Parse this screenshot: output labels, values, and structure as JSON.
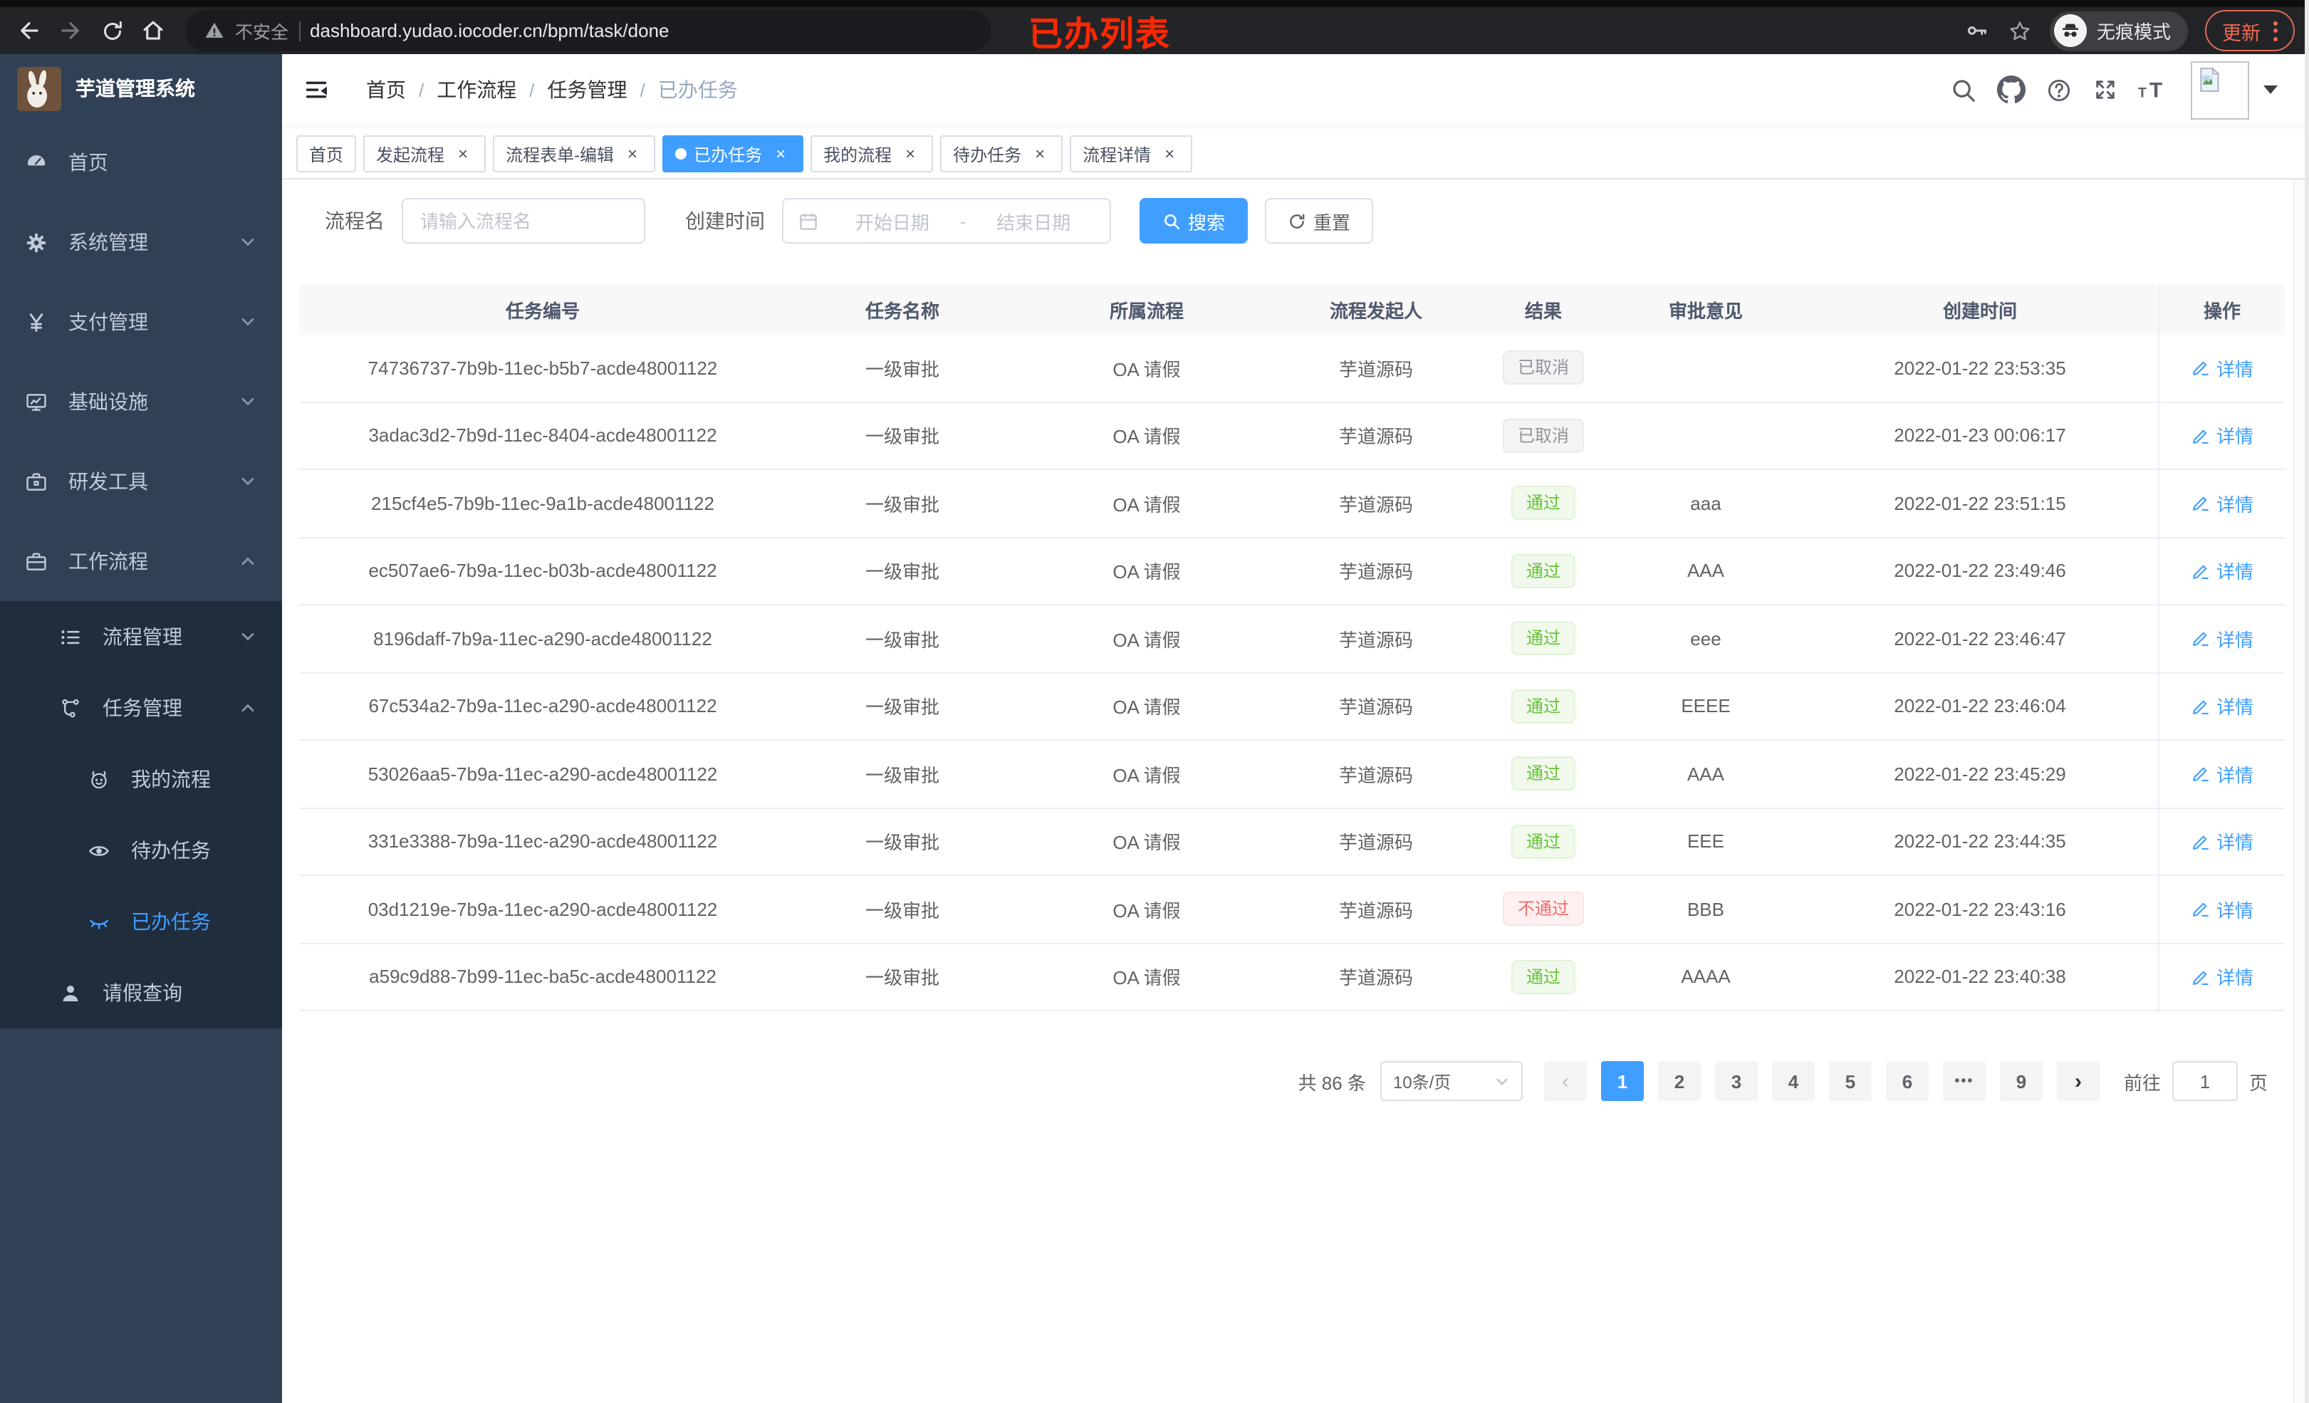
{
  "annotation": {
    "text": "已办列表"
  },
  "browser": {
    "security_label": "不安全",
    "url": "dashboard.yudao.iocoder.cn/bpm/task/done",
    "incognito_label": "无痕模式",
    "update_label": "更新",
    "nav_icons": [
      "back-icon",
      "forward-icon",
      "reload-icon",
      "home-icon"
    ],
    "right_icons": [
      "key-icon",
      "star-icon"
    ]
  },
  "sidebar": {
    "logo_title": "芋道管理系统",
    "items": [
      {
        "key": "home",
        "label": "首页",
        "icon": "dashboard-icon",
        "level": 1,
        "submenu": false,
        "chevron": "",
        "active": false
      },
      {
        "key": "system-mgmt",
        "label": "系统管理",
        "icon": "gear-icon",
        "level": 1,
        "submenu": false,
        "chevron": "down",
        "active": false
      },
      {
        "key": "payment-mgmt",
        "label": "支付管理",
        "icon": "yen-icon",
        "level": 1,
        "submenu": false,
        "chevron": "down",
        "active": false
      },
      {
        "key": "infrastructure",
        "label": "基础设施",
        "icon": "monitor-icon",
        "level": 1,
        "submenu": false,
        "chevron": "down",
        "active": false
      },
      {
        "key": "dev-tools",
        "label": "研发工具",
        "icon": "toolbox-icon",
        "level": 1,
        "submenu": false,
        "chevron": "down",
        "active": false
      },
      {
        "key": "workflow",
        "label": "工作流程",
        "icon": "briefcase-icon",
        "level": 1,
        "submenu": false,
        "chevron": "up",
        "active": false
      },
      {
        "key": "process-mgmt",
        "label": "流程管理",
        "icon": "list-icon",
        "level": 2,
        "submenu": true,
        "chevron": "down",
        "active": false
      },
      {
        "key": "task-mgmt",
        "label": "任务管理",
        "icon": "flow-icon",
        "level": 2,
        "submenu": true,
        "chevron": "up",
        "active": false
      },
      {
        "key": "my-process",
        "label": "我的流程",
        "icon": "face-icon",
        "level": 3,
        "submenu": true,
        "chevron": "",
        "active": false
      },
      {
        "key": "todo-tasks",
        "label": "待办任务",
        "icon": "eye-icon",
        "level": 3,
        "submenu": true,
        "chevron": "",
        "active": false
      },
      {
        "key": "done-tasks",
        "label": "已办任务",
        "icon": "eye-closed-icon",
        "level": 3,
        "submenu": true,
        "chevron": "",
        "active": true
      },
      {
        "key": "leave-query",
        "label": "请假查询",
        "icon": "user-icon",
        "level": 2,
        "submenu": true,
        "chevron": "",
        "active": false
      }
    ]
  },
  "navbar": {
    "breadcrumb": [
      "首页",
      "工作流程",
      "任务管理",
      "已办任务"
    ],
    "right_icons": [
      "search-icon",
      "github-icon",
      "help-icon",
      "fullscreen-icon",
      "font-size-icon"
    ]
  },
  "tags": [
    {
      "key": "home",
      "label": "首页",
      "closable": false,
      "active": false
    },
    {
      "key": "start-process",
      "label": "发起流程",
      "closable": true,
      "active": false
    },
    {
      "key": "form-edit",
      "label": "流程表单-编辑",
      "closable": true,
      "active": false
    },
    {
      "key": "done-tasks",
      "label": "已办任务",
      "closable": true,
      "active": true
    },
    {
      "key": "my-process",
      "label": "我的流程",
      "closable": true,
      "active": false
    },
    {
      "key": "todo-tasks",
      "label": "待办任务",
      "closable": true,
      "active": false
    },
    {
      "key": "process-detail",
      "label": "流程详情",
      "closable": true,
      "active": false
    }
  ],
  "filters": {
    "name_label": "流程名",
    "name_placeholder": "请输入流程名",
    "time_label": "创建时间",
    "start_placeholder": "开始日期",
    "range_separator": "-",
    "end_placeholder": "结束日期",
    "search_label": "搜索",
    "reset_label": "重置"
  },
  "table": {
    "columns": [
      "任务编号",
      "任务名称",
      "所属流程",
      "流程发起人",
      "结果",
      "审批意见",
      "创建时间",
      "操作"
    ],
    "action_label": "详情",
    "rows": [
      {
        "id": "74736737-7b9b-11ec-b5b7-acde48001122",
        "name": "一级审批",
        "process": "OA 请假",
        "starter": "芋道源码",
        "result": "已取消",
        "result_type": "info",
        "comment": "",
        "time": "2022-01-22 23:53:35"
      },
      {
        "id": "3adac3d2-7b9d-11ec-8404-acde48001122",
        "name": "一级审批",
        "process": "OA 请假",
        "starter": "芋道源码",
        "result": "已取消",
        "result_type": "info",
        "comment": "",
        "time": "2022-01-23 00:06:17"
      },
      {
        "id": "215cf4e5-7b9b-11ec-9a1b-acde48001122",
        "name": "一级审批",
        "process": "OA 请假",
        "starter": "芋道源码",
        "result": "通过",
        "result_type": "success",
        "comment": "aaa",
        "time": "2022-01-22 23:51:15"
      },
      {
        "id": "ec507ae6-7b9a-11ec-b03b-acde48001122",
        "name": "一级审批",
        "process": "OA 请假",
        "starter": "芋道源码",
        "result": "通过",
        "result_type": "success",
        "comment": "AAA",
        "time": "2022-01-22 23:49:46"
      },
      {
        "id": "8196daff-7b9a-11ec-a290-acde48001122",
        "name": "一级审批",
        "process": "OA 请假",
        "starter": "芋道源码",
        "result": "通过",
        "result_type": "success",
        "comment": "eee",
        "time": "2022-01-22 23:46:47"
      },
      {
        "id": "67c534a2-7b9a-11ec-a290-acde48001122",
        "name": "一级审批",
        "process": "OA 请假",
        "starter": "芋道源码",
        "result": "通过",
        "result_type": "success",
        "comment": "EEEE",
        "time": "2022-01-22 23:46:04"
      },
      {
        "id": "53026aa5-7b9a-11ec-a290-acde48001122",
        "name": "一级审批",
        "process": "OA 请假",
        "starter": "芋道源码",
        "result": "通过",
        "result_type": "success",
        "comment": "AAA",
        "time": "2022-01-22 23:45:29"
      },
      {
        "id": "331e3388-7b9a-11ec-a290-acde48001122",
        "name": "一级审批",
        "process": "OA 请假",
        "starter": "芋道源码",
        "result": "通过",
        "result_type": "success",
        "comment": "EEE",
        "time": "2022-01-22 23:44:35"
      },
      {
        "id": "03d1219e-7b9a-11ec-a290-acde48001122",
        "name": "一级审批",
        "process": "OA 请假",
        "starter": "芋道源码",
        "result": "不通过",
        "result_type": "danger",
        "comment": "BBB",
        "time": "2022-01-22 23:43:16"
      },
      {
        "id": "a59c9d88-7b99-11ec-ba5c-acde48001122",
        "name": "一级审批",
        "process": "OA 请假",
        "starter": "芋道源码",
        "result": "通过",
        "result_type": "success",
        "comment": "AAAA",
        "time": "2022-01-22 23:40:38"
      }
    ]
  },
  "pagination": {
    "total": "共 86 条",
    "page_size": "10条/页",
    "prev": "‹",
    "next": "›",
    "pages": [
      "1",
      "2",
      "3",
      "4",
      "5",
      "6",
      "•••",
      "9"
    ],
    "active_page": "1",
    "goto_label": "前往",
    "goto_value": "1",
    "unit_label": "页"
  },
  "colors": {
    "accent": "#409eff",
    "success": "#67c23a",
    "danger": "#f56c6c",
    "info": "#909399",
    "sidebar_bg": "#304156",
    "submenu_bg": "#1f2d3d",
    "annotation_red": "#fb2800",
    "update_orange": "#ed6a52"
  }
}
